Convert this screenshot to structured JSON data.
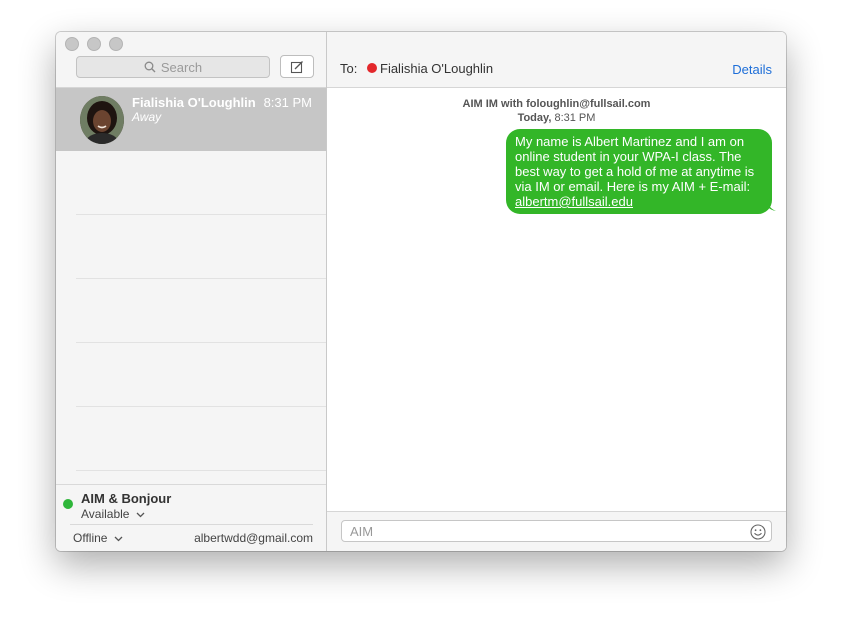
{
  "sidebar": {
    "search_placeholder": "Search",
    "conversation": {
      "name": "Fialishia O'Loughlin",
      "time": "8:31 PM",
      "status": "Away"
    },
    "account": {
      "name": "AIM & Bonjour",
      "status": "Available",
      "offline_label": "Offline",
      "email": "albertwdd@gmail.com",
      "status_color": "#2fb63a"
    }
  },
  "header": {
    "to_label": "To:",
    "recipient": "Fialishia O'Loughlin",
    "recipient_status_color": "#e3272b",
    "details_label": "Details"
  },
  "chat": {
    "info": "AIM IM with foloughlin@fullsail.com",
    "date_day": "Today,",
    "date_time": "8:31 PM",
    "message_text": "My name is Albert Martinez and I am on online student in your WPA-I class. The best way to get a hold of me at anytime is via IM or email. Here is my AIM + E-mail: ",
    "message_link": "albertm@fullsail.edu",
    "bubble_color": "#33b628"
  },
  "composer": {
    "placeholder": "AIM"
  }
}
